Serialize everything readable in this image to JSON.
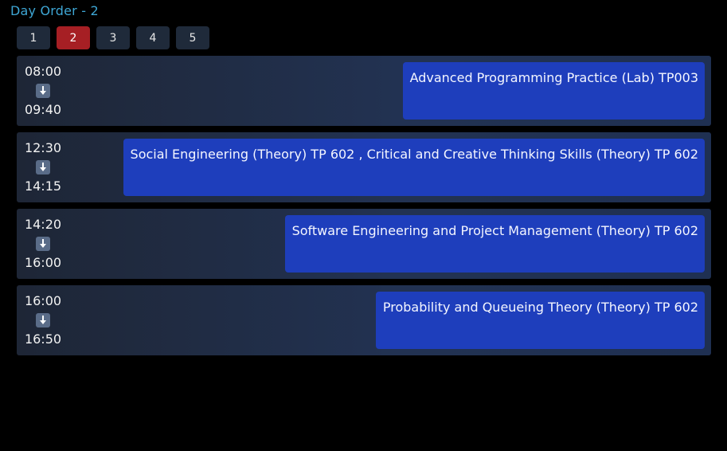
{
  "title": "Day Order - 2",
  "tabs": [
    {
      "label": "1",
      "active": false
    },
    {
      "label": "2",
      "active": true
    },
    {
      "label": "3",
      "active": false
    },
    {
      "label": "4",
      "active": false
    },
    {
      "label": "5",
      "active": false
    }
  ],
  "slots": [
    {
      "start": "08:00",
      "end": "09:40",
      "arrow_icon": "down-arrow-icon",
      "course": "Advanced Programming Practice (Lab) TP003"
    },
    {
      "start": "12:30",
      "end": "14:15",
      "arrow_icon": "down-arrow-icon",
      "course": "Social Engineering (Theory) TP 602 , Critical and Creative Thinking Skills (Theory) TP 602"
    },
    {
      "start": "14:20",
      "end": "16:00",
      "arrow_icon": "down-arrow-icon",
      "course": "Software Engineering and Project Management (Theory) TP 602"
    },
    {
      "start": "16:00",
      "end": "16:50",
      "arrow_icon": "down-arrow-icon",
      "course": "Probability and Queueing Theory (Theory) TP 602"
    }
  ],
  "colors": {
    "title": "#3ea6d4",
    "active_tab": "#a61f24",
    "tab": "#1f2a3a",
    "course_block": "#1e3ebc",
    "row_bg": "#223252"
  }
}
